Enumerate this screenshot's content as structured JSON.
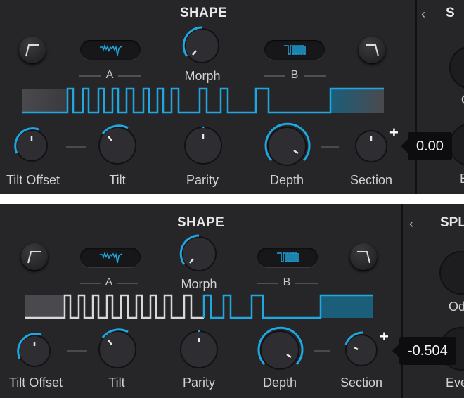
{
  "colors": {
    "accent": "#1ea7e0",
    "panel": "#262628",
    "text": "#d2d2d2",
    "wave_grey": "#d8d8d8"
  },
  "panels": [
    {
      "title": "SHAPE",
      "side_chevron": "‹",
      "side_title": "S",
      "side_labels": [
        "O",
        "E"
      ],
      "morph_label": "Morph",
      "a_label": "A",
      "b_label": "B",
      "knob_labels": [
        "Tilt Offset",
        "Tilt",
        "Parity",
        "Depth",
        "Section"
      ],
      "tooltip_value": "0.00",
      "section_plus": "+",
      "icons": [
        "ramp-up-icon",
        "wave-a-icon",
        "wave-b-icon",
        "ramp-down-icon"
      ]
    },
    {
      "title": "SHAPE",
      "side_chevron": "‹",
      "side_title": "SPL",
      "side_labels": [
        "Od",
        "Eve"
      ],
      "morph_label": "Morph",
      "a_label": "A",
      "b_label": "B",
      "knob_labels": [
        "Tilt Offset",
        "Tilt",
        "Parity",
        "Depth",
        "Section"
      ],
      "tooltip_value": "-0.504",
      "section_plus": "+",
      "icons": [
        "ramp-up-icon",
        "wave-a-icon",
        "wave-b-icon",
        "ramp-down-icon"
      ]
    }
  ]
}
